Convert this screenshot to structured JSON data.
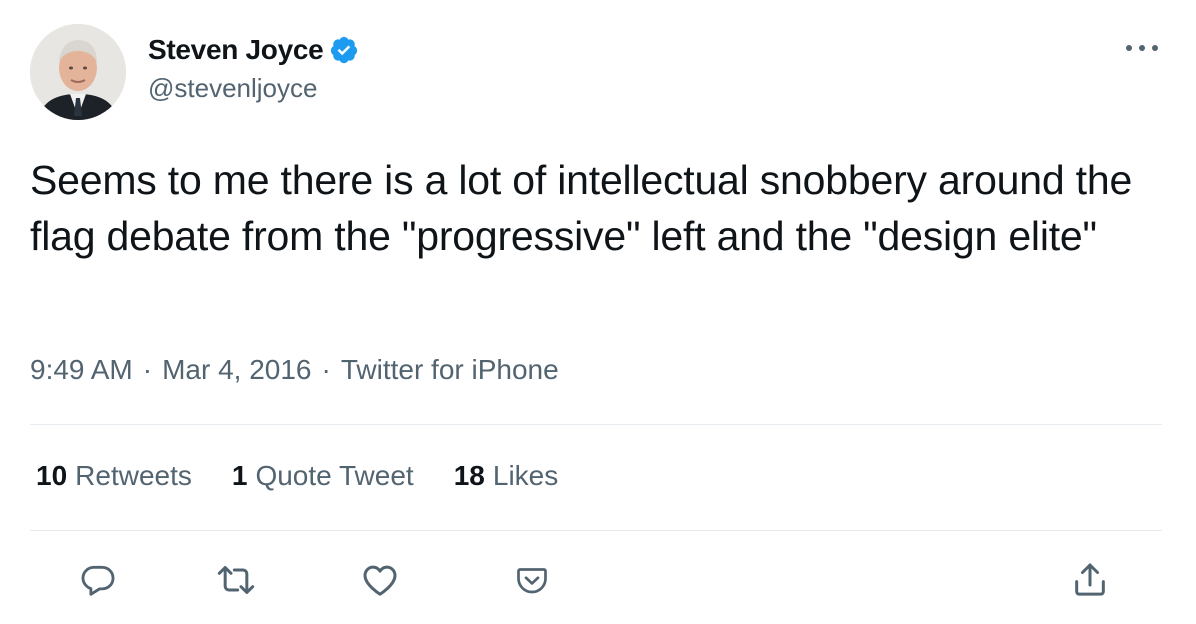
{
  "author": {
    "display_name": "Steven Joyce",
    "handle": "@stevenljoyce",
    "verified": true
  },
  "tweet": {
    "text": "Seems to me there is a lot of intellectual snobbery around the flag debate from the \"progressive\" left and the \"design elite\"",
    "time": "9:49 AM",
    "date": "Mar 4, 2016",
    "source": "Twitter for iPhone",
    "separator": "·"
  },
  "stats": {
    "retweets_count": "10",
    "retweets_label": "Retweets",
    "quotes_count": "1",
    "quotes_label": "Quote Tweet",
    "likes_count": "18",
    "likes_label": "Likes"
  },
  "actions": {
    "reply": "reply-icon",
    "retweet": "retweet-icon",
    "like": "heart-icon",
    "pocket": "pocket-icon",
    "share": "share-icon"
  },
  "colors": {
    "verified": "#1d9bf0",
    "text": "#0f1419",
    "secondary": "#536471",
    "divider": "#e6ecf0"
  }
}
